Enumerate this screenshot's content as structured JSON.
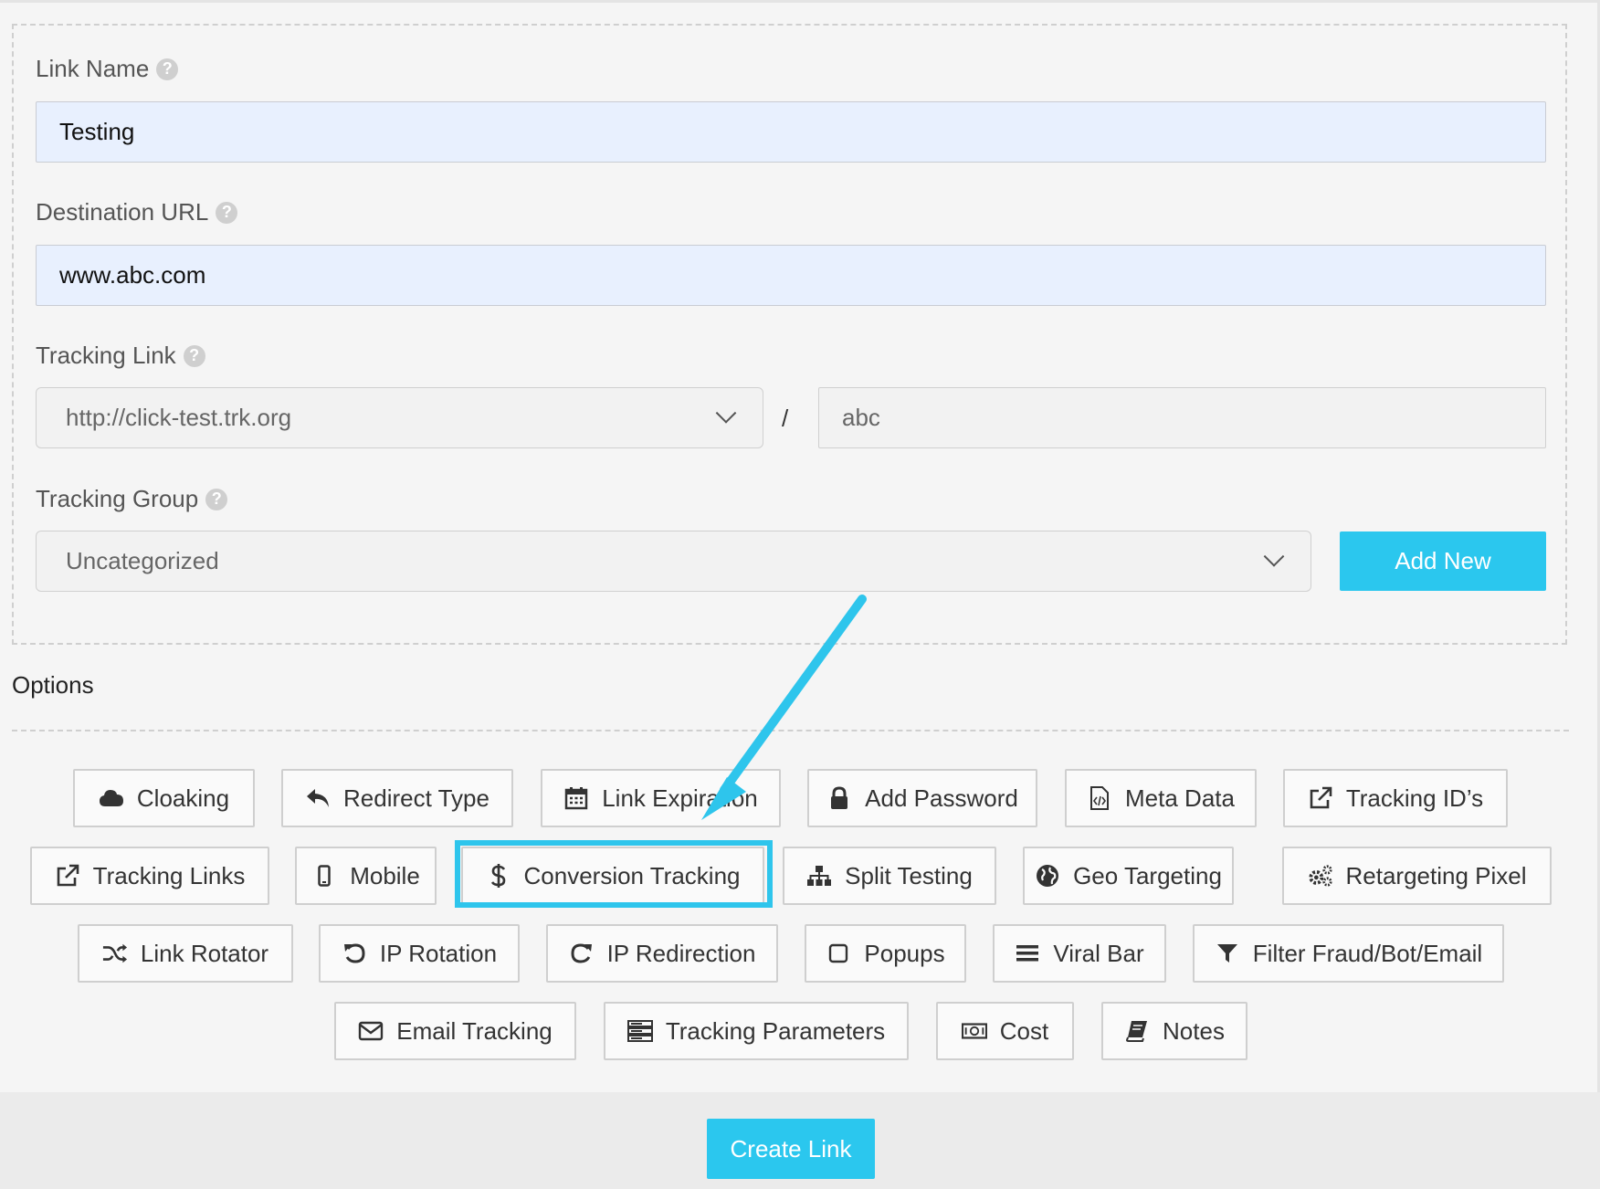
{
  "form": {
    "link_name": {
      "label": "Link Name",
      "value": "Testing"
    },
    "destination_url": {
      "label": "Destination URL",
      "value": "www.abc.com"
    },
    "tracking_link": {
      "label": "Tracking Link",
      "domain": "http://click-test.trk.org",
      "separator": "/",
      "slug": "abc"
    },
    "tracking_group": {
      "label": "Tracking Group",
      "value": "Uncategorized",
      "add_new_label": "Add New"
    },
    "help_glyph": "?"
  },
  "options": {
    "title": "Options",
    "buttons": [
      {
        "label": "Cloaking",
        "icon": "cloud-icon"
      },
      {
        "label": "Redirect Type",
        "icon": "reply-arrow-icon"
      },
      {
        "label": "Link Expiration",
        "icon": "calendar-icon"
      },
      {
        "label": "Add Password",
        "icon": "lock-icon"
      },
      {
        "label": "Meta Data",
        "icon": "code-file-icon"
      },
      {
        "label": "Tracking ID’s",
        "icon": "external-link-icon"
      },
      {
        "label": "Tracking Links",
        "icon": "external-link-icon"
      },
      {
        "label": "Mobile",
        "icon": "mobile-icon"
      },
      {
        "label": "Conversion Tracking",
        "icon": "dollar-icon"
      },
      {
        "label": "Split Testing",
        "icon": "sitemap-icon"
      },
      {
        "label": "Geo Targeting",
        "icon": "globe-icon"
      },
      {
        "label": "Retargeting Pixel",
        "icon": "gears-icon"
      },
      {
        "label": "Link Rotator",
        "icon": "shuffle-icon"
      },
      {
        "label": "IP Rotation",
        "icon": "undo-icon"
      },
      {
        "label": "IP Redirection",
        "icon": "redo-icon"
      },
      {
        "label": "Popups",
        "icon": "square-icon"
      },
      {
        "label": "Viral Bar",
        "icon": "bars-icon"
      },
      {
        "label": "Filter Fraud/Bot/Email",
        "icon": "filter-icon"
      },
      {
        "label": "Email Tracking",
        "icon": "envelope-icon"
      },
      {
        "label": "Tracking Parameters",
        "icon": "server-icon"
      },
      {
        "label": "Cost",
        "icon": "money-icon"
      },
      {
        "label": "Notes",
        "icon": "book-icon"
      }
    ]
  },
  "footer": {
    "create_label": "Create Link"
  },
  "colors": {
    "accent": "#2bc7ee",
    "input_fill": "#e8f0fe",
    "highlight": "#2ec5ec"
  }
}
